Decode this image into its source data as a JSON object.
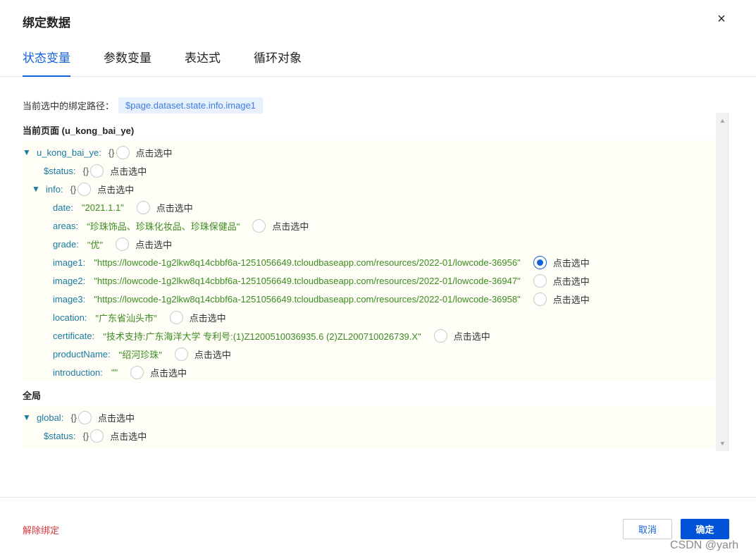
{
  "dialog": {
    "title": "绑定数据",
    "close_icon": "×"
  },
  "tabs": [
    {
      "label": "状态变量",
      "active": true
    },
    {
      "label": "参数变量",
      "active": false
    },
    {
      "label": "表达式",
      "active": false
    },
    {
      "label": "循环对象",
      "active": false
    }
  ],
  "binding_path": {
    "label": "当前选中的绑定路径：",
    "value": "$page.dataset.state.info.image1"
  },
  "pick_label": "点击选中",
  "icons": {
    "caret": "▼",
    "scroll_up": "▲",
    "scroll_down": "▼"
  },
  "sections": {
    "page": {
      "title": "当前页面 (u_kong_bai_ye)",
      "root": {
        "key": "u_kong_bai_ye:",
        "brace": "{}"
      },
      "status": {
        "key": "$status:",
        "brace": "{}"
      },
      "info": {
        "key": "info:",
        "brace": "{}"
      },
      "fields": [
        {
          "key": "date:",
          "value": "\"2021.1.1\"",
          "selected": false
        },
        {
          "key": "areas:",
          "value": "\"珍珠饰品、珍珠化妆品、珍珠保健品\"",
          "selected": false
        },
        {
          "key": "grade:",
          "value": "\"优\"",
          "selected": false
        },
        {
          "key": "image1:",
          "value": "\"https://lowcode-1g2lkw8q14cbbf6a-1251056649.tcloudbaseapp.com/resources/2022-01/lowcode-36956\"",
          "selected": true
        },
        {
          "key": "image2:",
          "value": "\"https://lowcode-1g2lkw8q14cbbf6a-1251056649.tcloudbaseapp.com/resources/2022-01/lowcode-36947\"",
          "selected": false
        },
        {
          "key": "image3:",
          "value": "\"https://lowcode-1g2lkw8q14cbbf6a-1251056649.tcloudbaseapp.com/resources/2022-01/lowcode-36958\"",
          "selected": false
        },
        {
          "key": "location:",
          "value": "\"广东省汕头市\"",
          "selected": false
        },
        {
          "key": "certificate:",
          "value": "\"技术支持:广东海洋大学 专利号:(1)Z1200510036935.6 (2)ZL200710026739.X\"",
          "selected": false
        },
        {
          "key": "productName:",
          "value": "\"绍河珍珠\"",
          "selected": false
        },
        {
          "key": "introduction:",
          "value": "\"\"",
          "selected": false
        }
      ]
    },
    "global": {
      "title": "全局",
      "root": {
        "key": "global:",
        "brace": "{}"
      },
      "status": {
        "key": "$status:",
        "brace": "{}"
      }
    }
  },
  "footer": {
    "unbind_label": "解除绑定",
    "cancel_label": "取消",
    "confirm_label": "确定",
    "watermark": "CSDN @yarh"
  },
  "colors": {
    "primary": "#0052d9",
    "tab_active": "#1463d6",
    "key": "#1a7aa0",
    "value": "#3c8c1f",
    "danger": "#d9363e"
  }
}
